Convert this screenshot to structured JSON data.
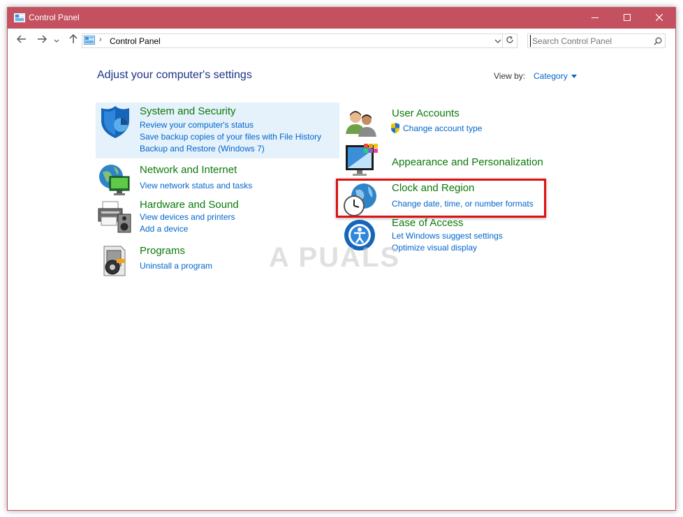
{
  "window": {
    "title": "Control Panel"
  },
  "icons": {
    "app": "control-panel-icon",
    "minimize": "minimize-icon",
    "maximize": "maximize-icon",
    "close": "close-icon",
    "back": "back-arrow-icon",
    "forward": "forward-arrow-icon",
    "recent": "chevron-down-icon",
    "up": "up-arrow-icon",
    "refresh": "refresh-icon",
    "search": "search-icon"
  },
  "address": {
    "separator": "›",
    "crumb": "Control Panel"
  },
  "search": {
    "placeholder": "Search Control Panel"
  },
  "main": {
    "heading": "Adjust your computer's settings",
    "view_by_label": "View by:",
    "view_by_value": "Category"
  },
  "categories_left": [
    {
      "title": "System and Security",
      "icon": "shield-icon",
      "links": [
        "Review your computer's status",
        "Save backup copies of your files with File History",
        "Backup and Restore (Windows 7)"
      ]
    },
    {
      "title": "Network and Internet",
      "icon": "network-globe-icon",
      "links": [
        "View network status and tasks"
      ]
    },
    {
      "title": "Hardware and Sound",
      "icon": "printer-speaker-icon",
      "links": [
        "View devices and printers",
        "Add a device"
      ]
    },
    {
      "title": "Programs",
      "icon": "programs-box-icon",
      "links": [
        "Uninstall a program"
      ]
    }
  ],
  "categories_right": [
    {
      "title": "User Accounts",
      "icon": "users-icon",
      "links": [
        "Change account type"
      ],
      "link_icon": "uac-shield-icon"
    },
    {
      "title": "Appearance and Personalization",
      "icon": "monitor-palette-icon",
      "links": []
    },
    {
      "title": "Clock and Region",
      "icon": "clock-globe-icon",
      "links": [
        "Change date, time, or number formats"
      ]
    },
    {
      "title": "Ease of Access",
      "icon": "ease-of-access-icon",
      "links": [
        "Let Windows suggest settings",
        "Optimize visual display"
      ]
    }
  ],
  "watermark": "A PUALS",
  "colors": {
    "titlebar": "#c4515f",
    "category_title": "#0b7a0b",
    "link": "#0066cc",
    "heading": "#1e3287",
    "highlight": "#e5f1fb",
    "annotation_box": "#dd1111"
  }
}
